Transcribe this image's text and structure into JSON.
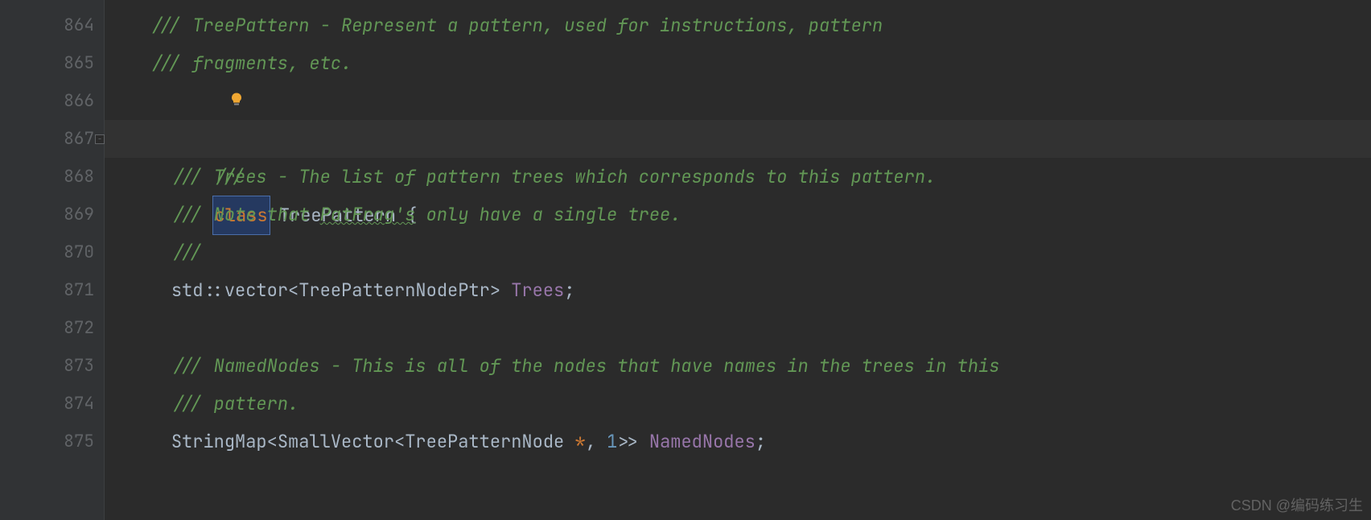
{
  "editor": {
    "lines": [
      {
        "num": "864",
        "indent": "  ",
        "tokens": [
          {
            "cls": "comment",
            "text": "/// TreePattern - Represent a pattern, used for instructions, pattern"
          }
        ]
      },
      {
        "num": "865",
        "indent": "  ",
        "tokens": [
          {
            "cls": "comment",
            "text": "/// fragments, etc."
          }
        ]
      },
      {
        "num": "866",
        "indent": "  ",
        "tokens": [
          {
            "cls": "comment",
            "text": "///"
          }
        ],
        "bulb": true
      },
      {
        "num": "867",
        "indent": "  ",
        "highlighted": true,
        "fold": true,
        "gutter_arrows": true,
        "tokens_literal": "class TreePattern {"
      },
      {
        "num": "868",
        "indent": "    ",
        "tokens": [
          {
            "cls": "comment",
            "text": "/// Trees - The list of pattern trees which corresponds to this pattern."
          }
        ]
      },
      {
        "num": "869",
        "indent": "    ",
        "tokens": [
          {
            "cls": "comment",
            "text": "/// Note that PatFrag's only have a single tree."
          }
        ],
        "wavy_word": "PatFrag's"
      },
      {
        "num": "870",
        "indent": "    ",
        "tokens": [
          {
            "cls": "comment",
            "text": "///"
          }
        ]
      },
      {
        "num": "871",
        "indent": "    ",
        "tokens_literal": "std::vector<TreePatternNodePtr> Trees;"
      },
      {
        "num": "872",
        "indent": "",
        "tokens": []
      },
      {
        "num": "873",
        "indent": "    ",
        "tokens": [
          {
            "cls": "comment",
            "text": "/// NamedNodes - This is all of the nodes that have names in the trees in this"
          }
        ]
      },
      {
        "num": "874",
        "indent": "    ",
        "tokens": [
          {
            "cls": "comment",
            "text": "/// pattern."
          }
        ]
      },
      {
        "num": "875",
        "indent": "    ",
        "tokens_literal": "StringMap<SmallVector<TreePatternNode *, 1>> NamedNodes;"
      }
    ]
  },
  "l867": {
    "class_kw": "class",
    "class_name": "TreePattern",
    "brace": "{"
  },
  "l871": {
    "ns": "std",
    "sep": "::",
    "vec": "vector",
    "lt": "<",
    "param": "TreePatternNodePtr",
    "gt": ">",
    "sp": " ",
    "name": "Trees",
    "semi": ";"
  },
  "l875": {
    "smap": "StringMap",
    "lt": "<",
    "svec": "SmallVector",
    "lt2": "<",
    "node": "TreePatternNode",
    "sp": " ",
    "star": "*",
    "comma": ",",
    "sp2": " ",
    "one": "1",
    "gt": ">>",
    "sp3": " ",
    "name": "NamedNodes",
    "semi": ";"
  },
  "l869_parts": {
    "pre": "/// Note that ",
    "wavy": "PatFrag's",
    "post": " only have a single tree."
  },
  "watermark": "CSDN @编码练习生"
}
